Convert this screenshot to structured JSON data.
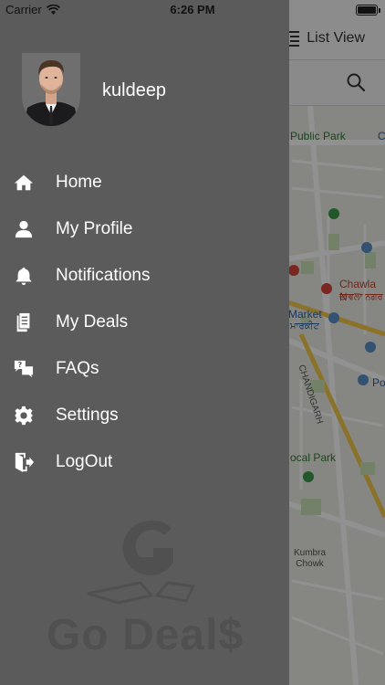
{
  "status_bar": {
    "carrier": "Carrier",
    "time": "6:26 PM"
  },
  "app": {
    "list_view_label": "List View",
    "map_labels": {
      "public_park": "Public Park",
      "chawla": "Chawla N",
      "chawla_punjabi": "ਚਾਵਲਾ ਨਗਰ",
      "market": "Market",
      "market_punjabi": "ਮਾਰਕੀਟ",
      "chandigarh": "CHANDIGARH",
      "local_park": "ocal Park",
      "po": "Po",
      "kumbra_chowk": "Kumbra\nChowk",
      "c": "C"
    }
  },
  "drawer": {
    "username": "kuldeep",
    "menu": [
      {
        "label": "Home",
        "icon": "home-icon"
      },
      {
        "label": "My Profile",
        "icon": "user-icon"
      },
      {
        "label": "Notifications",
        "icon": "bell-icon"
      },
      {
        "label": "My Deals",
        "icon": "deals-icon"
      },
      {
        "label": "FAQs",
        "icon": "faq-icon"
      },
      {
        "label": "Settings",
        "icon": "gear-icon"
      },
      {
        "label": "LogOut",
        "icon": "logout-icon"
      }
    ],
    "watermark_text": "Go Deal$"
  },
  "colors": {
    "drawer_bg": "#5b5b5b",
    "dim_overlay": "rgba(0,0,0,0.43)",
    "map_bg": "#ecebe6"
  }
}
